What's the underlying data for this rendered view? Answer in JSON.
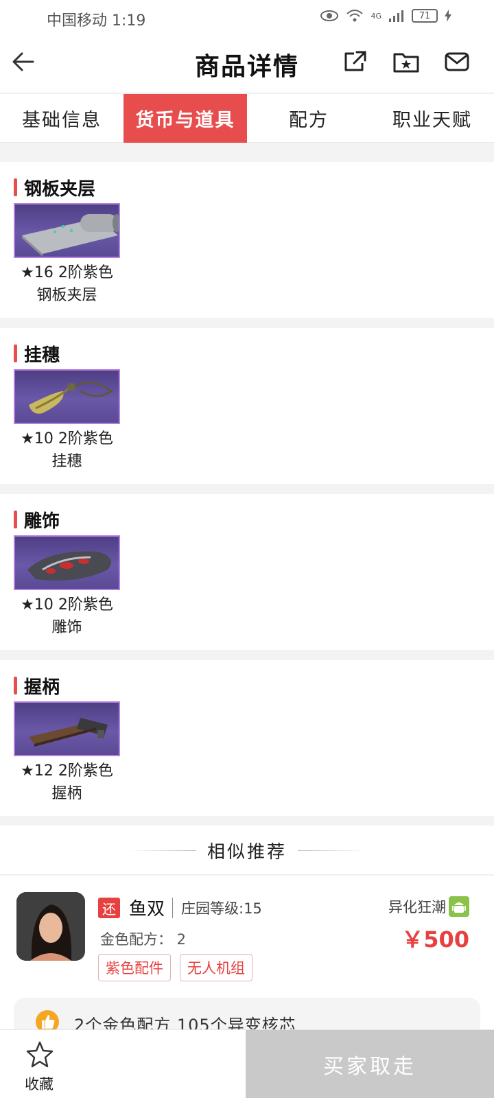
{
  "status_bar": {
    "carrier_time": "中国移动 1:19",
    "network": "4G",
    "battery": "71"
  },
  "nav": {
    "title": "商品详情"
  },
  "tabs": [
    {
      "label": "基础信息"
    },
    {
      "label": "货币与道具"
    },
    {
      "label": "配方"
    },
    {
      "label": "职业天赋"
    }
  ],
  "items": [
    {
      "title": "钢板夹层",
      "line1": "★16 2阶紫色",
      "line2": "钢板夹层"
    },
    {
      "title": "挂穗",
      "line1": "★10 2阶紫色",
      "line2": "挂穗"
    },
    {
      "title": "雕饰",
      "line1": "★10 2阶紫色",
      "line2": "雕饰"
    },
    {
      "title": "握柄",
      "line1": "★12 2阶紫色",
      "line2": "握柄"
    }
  ],
  "recommend": {
    "title": "相似推荐"
  },
  "card": {
    "badge": "还",
    "seller": "鱼双",
    "manor_level": "庄园等级:15",
    "server": "异化狂潮",
    "recipe": "金色配方： 2",
    "price": "￥500",
    "tags": [
      "紫色配件",
      "无人机组"
    ],
    "summary": "2个金色配方 105个异变核芯"
  },
  "bottom": {
    "fav_label": "收藏",
    "buy_label": "买家取走"
  },
  "colors": {
    "accent": "#e84d4d",
    "item_border": "#b57fe0"
  }
}
